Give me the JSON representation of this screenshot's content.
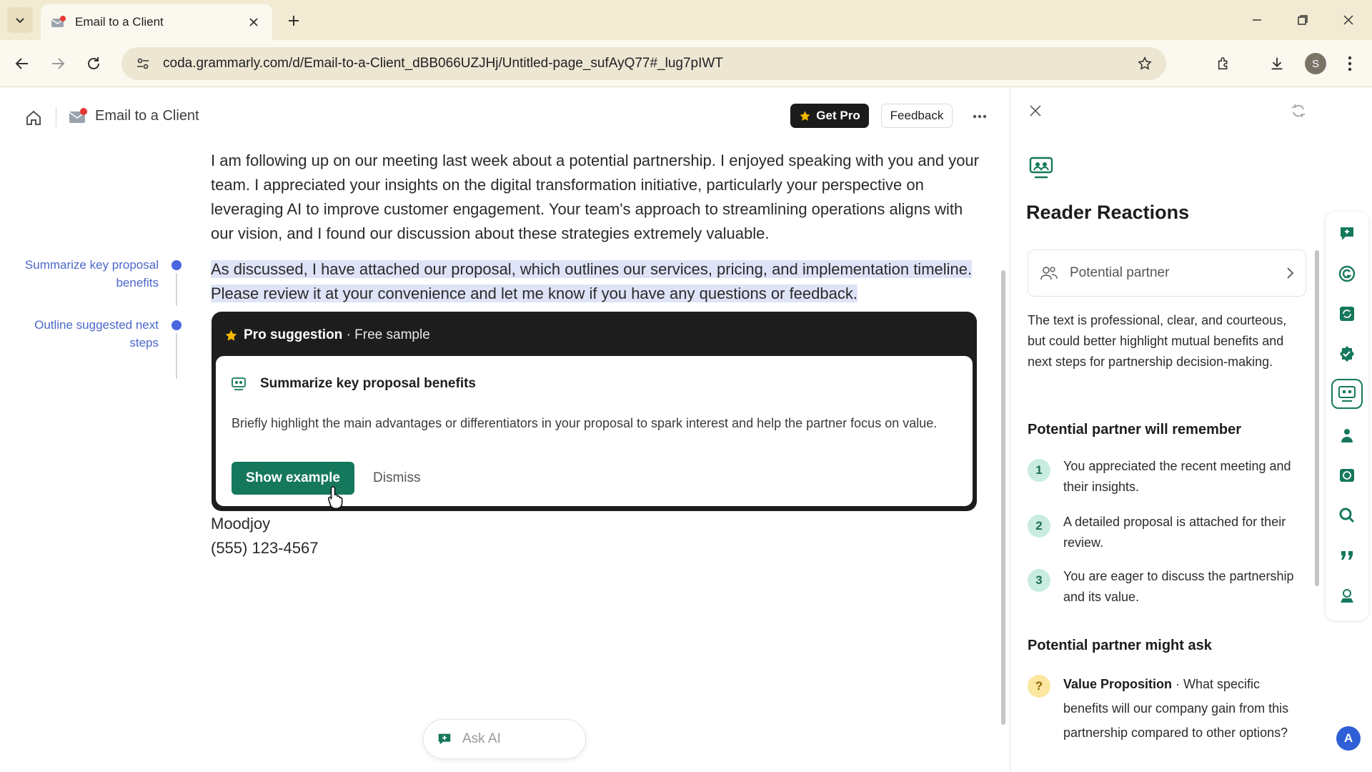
{
  "browser": {
    "tab_title": "Email to a Client",
    "url": "coda.grammarly.com/d/Email-to-a-Client_dBB066UZJHj/Untitled-page_sufAyQ77#_lug7pIWT",
    "profile_initial": "S"
  },
  "doc": {
    "title": "Email to a Client",
    "get_pro_label": "Get Pro",
    "feedback_label": "Feedback",
    "outline": [
      {
        "label": "Summarize key proposal benefits"
      },
      {
        "label": "Outline suggested next steps"
      }
    ],
    "paragraph1": "I am following up on our meeting last week about a potential partnership. I enjoyed speaking with you and your team. I appreciated your insights on the digital transformation initiative, particularly your perspective on leveraging AI to improve customer engagement. Your team's approach to streamlining operations aligns with our vision, and I found our discussion about these strategies extremely valuable.",
    "paragraph2": "As discussed, I have attached our proposal, which outlines our services, pricing, and implementation timeline. Please review it at your convenience and let me know if you have any questions or feedback.",
    "suggestion": {
      "header_bold": "Pro suggestion",
      "header_sub": " · Free sample",
      "title": "Summarize key proposal benefits",
      "body": "Briefly highlight the main advantages or differentiators in your proposal to spark interest and help the partner focus on value.",
      "show_example_label": "Show example",
      "dismiss_label": "Dismiss"
    },
    "signature_name": "Moodjoy",
    "signature_phone": "(555) 123-4567",
    "ask_ai_label": "Ask AI"
  },
  "panel": {
    "title": "Reader Reactions",
    "persona": "Potential partner",
    "summary": "The text is professional, clear, and courteous, but could better highlight mutual benefits and next steps for partnership decision-making.",
    "remember_heading": "Potential partner will remember",
    "remember_items": [
      {
        "num": "1",
        "text": "You appreciated the recent meeting and their insights."
      },
      {
        "num": "2",
        "text": "A detailed proposal is attached for their review."
      },
      {
        "num": "3",
        "text": "You are eager to discuss the partnership and its value."
      }
    ],
    "ask_heading": "Potential partner might ask",
    "ask_items": [
      {
        "mark": "?",
        "title": "Value Proposition",
        "text": " · What specific benefits will our company gain from this partnership compared to other options?"
      }
    ]
  },
  "user_avatar_initial": "A",
  "colors": {
    "accent_green": "#15785c",
    "selection": "#dfe3f7",
    "outline_blue": "#4a67c8"
  }
}
